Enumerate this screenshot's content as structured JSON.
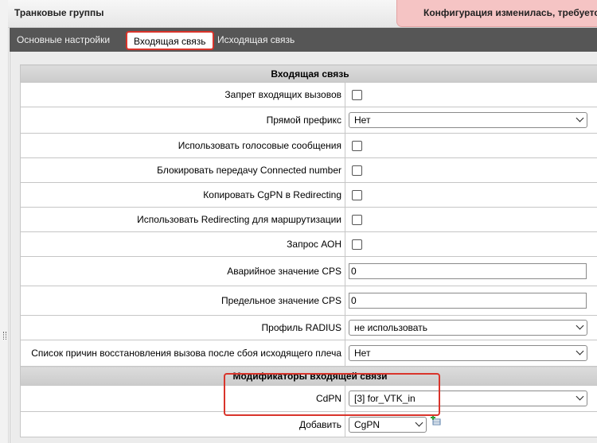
{
  "header": {
    "title": "Транковые группы"
  },
  "notification": {
    "text": "Конфигурация изменилась, требуется"
  },
  "tabs": [
    {
      "label": "Основные настройки"
    },
    {
      "label": "Входящая связь",
      "active": true
    },
    {
      "label": "Исходящая связь"
    }
  ],
  "form": {
    "section_incoming": "Входящая связь",
    "rows": [
      {
        "label": "Запрет входящих вызовов",
        "type": "checkbox",
        "checked": false
      },
      {
        "label": "Прямой префикс",
        "type": "select",
        "value": "Нет"
      },
      {
        "label": "Использовать голосовые сообщения",
        "type": "checkbox",
        "checked": false
      },
      {
        "label": "Блокировать передачу Connected number",
        "type": "checkbox",
        "checked": false
      },
      {
        "label": "Копировать CgPN в Redirecting",
        "type": "checkbox",
        "checked": false
      },
      {
        "label": "Использовать Redirecting для маршрутизации",
        "type": "checkbox",
        "checked": false
      },
      {
        "label": "Запрос АОН",
        "type": "checkbox",
        "checked": false
      },
      {
        "label": "Аварийное значение CPS",
        "type": "input",
        "value": "0"
      },
      {
        "label": "Предельное значение CPS",
        "type": "input",
        "value": "0"
      },
      {
        "label": "Профиль RADIUS",
        "type": "select",
        "value": "не использовать"
      },
      {
        "label": "Список причин восстановления вызова после сбоя исходящего плеча",
        "type": "select",
        "value": "Нет"
      }
    ],
    "section_modifiers": "Модификаторы входящей связи",
    "cdpn": {
      "label": "CdPN",
      "value": "[3] for_VTK_in"
    },
    "add": {
      "label": "Добавить",
      "value": "CgPN"
    }
  },
  "icons": {
    "add": "add-row-icon",
    "chevron": "chevron-down-icon",
    "checkbox": "checkbox-icon"
  },
  "colors": {
    "highlight": "#d9342b",
    "tabbar": "#565656",
    "notification_bg": "#f5c4c4"
  }
}
